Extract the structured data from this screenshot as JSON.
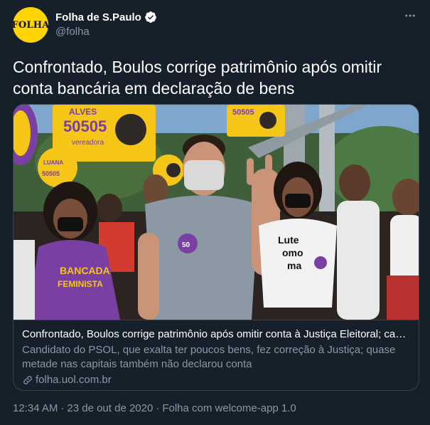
{
  "author": {
    "display_name": "Folha de S.Paulo",
    "handle": "@folha",
    "avatar_text": "FOLHA",
    "verified": true
  },
  "tweet": {
    "text": "Confrontado, Boulos corrige patrimônio após omitir conta bancária em declaração de bens"
  },
  "card": {
    "title": "Confrontado, Boulos corrige patrimônio após omitir conta à Justiça Eleitoral; can…",
    "description": "Candidato do PSOL, que exalta ter poucos bens, fez correção à Justiça; quase metade nas capitais também não declarou conta",
    "domain": "folha.uol.com.br",
    "image": {
      "sign_left": {
        "line1": "ALVES",
        "line2": "50505",
        "line3": "vereadora"
      },
      "sign_right": {
        "line1": "50505"
      },
      "sign_small": {
        "line1": "LUANA",
        "line2": "50505"
      },
      "shirt_left": {
        "line1": "BANCADA",
        "line2": "FEMINISTA"
      },
      "shirt_right": {
        "line1": "Lute",
        "line2": "omo",
        "line3": "ma"
      },
      "sticker": "50"
    }
  },
  "meta": {
    "time": "12:34 AM",
    "separator": "·",
    "date": "23 de out de 2020",
    "source": "Folha com welcome-app 1.0"
  },
  "colors": {
    "background": "#15202b",
    "secondary_text": "#8899a6",
    "border": "#38444d",
    "avatar_bg": "#ffd400",
    "verified": "#ffffff",
    "psol_yellow": "#f5c518",
    "psol_purple": "#7a3fa3"
  }
}
